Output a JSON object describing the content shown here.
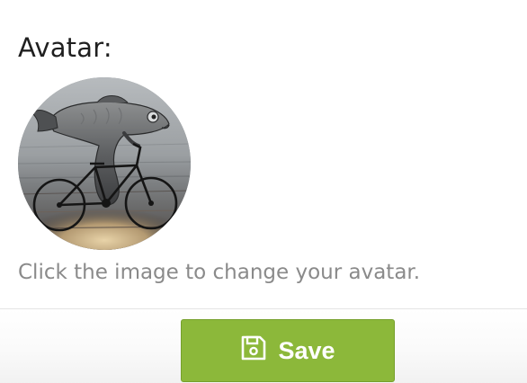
{
  "avatar": {
    "heading": "Avatar:",
    "hint": "Click the image to change your avatar.",
    "image_icon": "avatar-photo"
  },
  "footer": {
    "save_label": "Save",
    "save_icon": "floppy-disk-icon",
    "save_color": "#8cb83a"
  }
}
